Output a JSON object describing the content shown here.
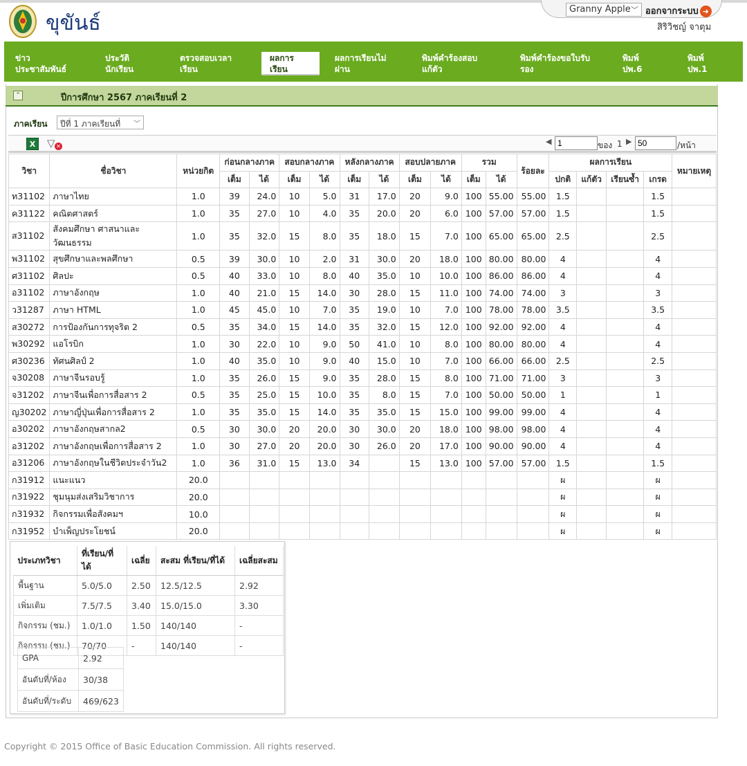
{
  "header": {
    "brand": "ขุขันธ์",
    "user_select": "Granny Apple",
    "logout": "ออกจากระบบ",
    "username": "สิริวิชญ์ จาตุม"
  },
  "nav": [
    {
      "l1": "ข่าว",
      "l2": "ประชาสัมพันธ์"
    },
    {
      "l1": "ประวัติ",
      "l2": "นักเรียน"
    },
    {
      "l1": "ตรวจสอบเวลา",
      "l2": "เรียน"
    },
    {
      "l1": "ผลการ",
      "l2": "เรียน"
    },
    {
      "l1": "ผลการเรียนไม่",
      "l2": "ผ่าน"
    },
    {
      "l1": "พิมพ์คำร้องสอบ",
      "l2": "แก้ตัว"
    },
    {
      "l1": "พิมพ์คำร้องขอใบรับ",
      "l2": "รอง"
    },
    {
      "l1": "พิมพ์",
      "l2": "ปพ.6"
    },
    {
      "l1": "พิมพ์",
      "l2": "ปพ.1"
    }
  ],
  "panel": {
    "title": "ปีการศึกษา 2567 ภาคเรียนที่ 2",
    "term_label": "ภาคเรียน",
    "term_value": "ปีที่ 1 ภาคเรียนที่"
  },
  "pager": {
    "page": "1",
    "of_label": "ของ",
    "total": "1",
    "per_page": "50",
    "per_label": "/หน้า"
  },
  "columns": {
    "subject_code": "วิชา",
    "subject_name": "ชื่อวิชา",
    "credit": "หน่วยกิต",
    "before_mid": "ก่อนกลางภาค",
    "mid_exam": "สอบกลางภาค",
    "after_mid": "หลังกลางภาค",
    "final_exam": "สอบปลายภาค",
    "total": "รวม",
    "percent": "ร้อยละ",
    "result": "ผลการเรียน",
    "remark": "หมายเหตุ",
    "full": "เต็ม",
    "got": "ได้",
    "normal": "ปกติ",
    "retest": "แก้ตัว",
    "repeat": "เรียนซ้ำ",
    "grade": "เกรด"
  },
  "rows": [
    [
      "ท31102",
      "ภาษาไทย",
      "1.0",
      "39",
      "24.0",
      "10",
      "5.0",
      "31",
      "17.0",
      "20",
      "9.0",
      "100",
      "55.00",
      "55.00",
      "1.5",
      "",
      "",
      "1.5",
      ""
    ],
    [
      "ค31122",
      "คณิตศาสตร์",
      "1.0",
      "35",
      "27.0",
      "10",
      "4.0",
      "35",
      "20.0",
      "20",
      "6.0",
      "100",
      "57.00",
      "57.00",
      "1.5",
      "",
      "",
      "1.5",
      ""
    ],
    [
      "ส31102",
      "สังคมศึกษา ศาสนาและวัฒนธรรม",
      "1.0",
      "35",
      "32.0",
      "15",
      "8.0",
      "35",
      "18.0",
      "15",
      "7.0",
      "100",
      "65.00",
      "65.00",
      "2.5",
      "",
      "",
      "2.5",
      ""
    ],
    [
      "พ31102",
      "สุขศึกษาและพลศึกษา",
      "0.5",
      "39",
      "30.0",
      "10",
      "2.0",
      "31",
      "30.0",
      "20",
      "18.0",
      "100",
      "80.00",
      "80.00",
      "4",
      "",
      "",
      "4",
      ""
    ],
    [
      "ศ31102",
      "ศิลปะ",
      "0.5",
      "40",
      "33.0",
      "10",
      "8.0",
      "40",
      "35.0",
      "10",
      "10.0",
      "100",
      "86.00",
      "86.00",
      "4",
      "",
      "",
      "4",
      ""
    ],
    [
      "อ31102",
      "ภาษาอังกฤษ",
      "1.0",
      "40",
      "21.0",
      "15",
      "14.0",
      "30",
      "28.0",
      "15",
      "11.0",
      "100",
      "74.00",
      "74.00",
      "3",
      "",
      "",
      "3",
      ""
    ],
    [
      "ว31287",
      "ภาษา HTML",
      "1.0",
      "45",
      "45.0",
      "10",
      "7.0",
      "35",
      "19.0",
      "10",
      "7.0",
      "100",
      "78.00",
      "78.00",
      "3.5",
      "",
      "",
      "3.5",
      ""
    ],
    [
      "ส30272",
      "การป้องกันการทุจริต 2",
      "0.5",
      "35",
      "34.0",
      "15",
      "14.0",
      "35",
      "32.0",
      "15",
      "12.0",
      "100",
      "92.00",
      "92.00",
      "4",
      "",
      "",
      "4",
      ""
    ],
    [
      "พ30292",
      "แอโรบิก",
      "1.0",
      "30",
      "22.0",
      "10",
      "9.0",
      "50",
      "41.0",
      "10",
      "8.0",
      "100",
      "80.00",
      "80.00",
      "4",
      "",
      "",
      "4",
      ""
    ],
    [
      "ศ30236",
      "ทัศนศิลป์ 2",
      "1.0",
      "40",
      "35.0",
      "10",
      "9.0",
      "40",
      "15.0",
      "10",
      "7.0",
      "100",
      "66.00",
      "66.00",
      "2.5",
      "",
      "",
      "2.5",
      ""
    ],
    [
      "จ30208",
      "ภาษาจีนรอบรู้",
      "1.0",
      "35",
      "26.0",
      "15",
      "9.0",
      "35",
      "28.0",
      "15",
      "8.0",
      "100",
      "71.00",
      "71.00",
      "3",
      "",
      "",
      "3",
      ""
    ],
    [
      "จ31202",
      "ภาษาจีนเพื่อการสื่อสาร 2",
      "0.5",
      "35",
      "25.0",
      "15",
      "10.0",
      "35",
      "8.0",
      "15",
      "7.0",
      "100",
      "50.00",
      "50.00",
      "1",
      "",
      "",
      "1",
      ""
    ],
    [
      "ญ30202",
      "ภาษาญี่ปุ่นเพื่อการสื่อสาร 2",
      "1.0",
      "35",
      "35.0",
      "15",
      "14.0",
      "35",
      "35.0",
      "15",
      "15.0",
      "100",
      "99.00",
      "99.00",
      "4",
      "",
      "",
      "4",
      ""
    ],
    [
      "อ30202",
      "ภาษาอังกฤษสากล2",
      "0.5",
      "30",
      "30.0",
      "20",
      "20.0",
      "30",
      "30.0",
      "20",
      "18.0",
      "100",
      "98.00",
      "98.00",
      "4",
      "",
      "",
      "4",
      ""
    ],
    [
      "อ31202",
      "ภาษาอังกฤษเพื่อการสื่อสาร 2",
      "1.0",
      "30",
      "27.0",
      "20",
      "20.0",
      "30",
      "26.0",
      "20",
      "17.0",
      "100",
      "90.00",
      "90.00",
      "4",
      "",
      "",
      "4",
      ""
    ],
    [
      "อ31206",
      "ภาษาอังกฤษในชีวิตประจำวัน2",
      "1.0",
      "36",
      "31.0",
      "15",
      "13.0",
      "34",
      "",
      "15",
      "13.0",
      "100",
      "57.00",
      "57.00",
      "1.5",
      "",
      "",
      "1.5",
      ""
    ],
    [
      "ก31912",
      "แนะแนว",
      "20.0",
      "",
      "",
      "",
      "",
      "",
      "",
      "",
      "",
      "",
      "",
      "",
      "ผ",
      "",
      "",
      "ผ",
      ""
    ],
    [
      "ก31922",
      "ชุมนุมส่งเสริมวิชาการ",
      "20.0",
      "",
      "",
      "",
      "",
      "",
      "",
      "",
      "",
      "",
      "",
      "",
      "ผ",
      "",
      "",
      "ผ",
      ""
    ],
    [
      "ก31932",
      "กิจกรรมเพื่อสังคมฯ",
      "10.0",
      "",
      "",
      "",
      "",
      "",
      "",
      "",
      "",
      "",
      "",
      "",
      "ผ",
      "",
      "",
      "ผ",
      ""
    ],
    [
      "ก31952",
      "บำเพ็ญประโยชน์",
      "20.0",
      "",
      "",
      "",
      "",
      "",
      "",
      "",
      "",
      "",
      "",
      "",
      "ผ",
      "",
      "",
      "ผ",
      ""
    ]
  ],
  "summary": {
    "headers": [
      "ประเภทวิชา",
      "ที่เรียน/ที่ได้",
      "เฉลี่ย",
      "สะสม ที่เรียน/ที่ได้",
      "เฉลี่ยสะสม"
    ],
    "rows": [
      [
        "พื้นฐาน",
        "5.0/5.0",
        "2.50",
        "12.5/12.5",
        "2.92"
      ],
      [
        "เพิ่มเติม",
        "7.5/7.5",
        "3.40",
        "15.0/15.0",
        "3.30"
      ],
      [
        "กิจกรรม (ชม.)",
        "1.0/1.0",
        "1.50",
        "140/140",
        "-"
      ],
      [
        "กิจกรรม (ชม.)",
        "70/70",
        "-",
        "140/140",
        "-"
      ]
    ],
    "gpa": [
      [
        "GPA",
        "2.92"
      ],
      [
        "อันดับที่/ห้อง",
        "30/38"
      ],
      [
        "อันดับที่/ระดับ",
        "469/623"
      ]
    ]
  },
  "footer": {
    "copyright": "Copyright © 2015 Office of Basic Education Commission. All rights reserved."
  }
}
